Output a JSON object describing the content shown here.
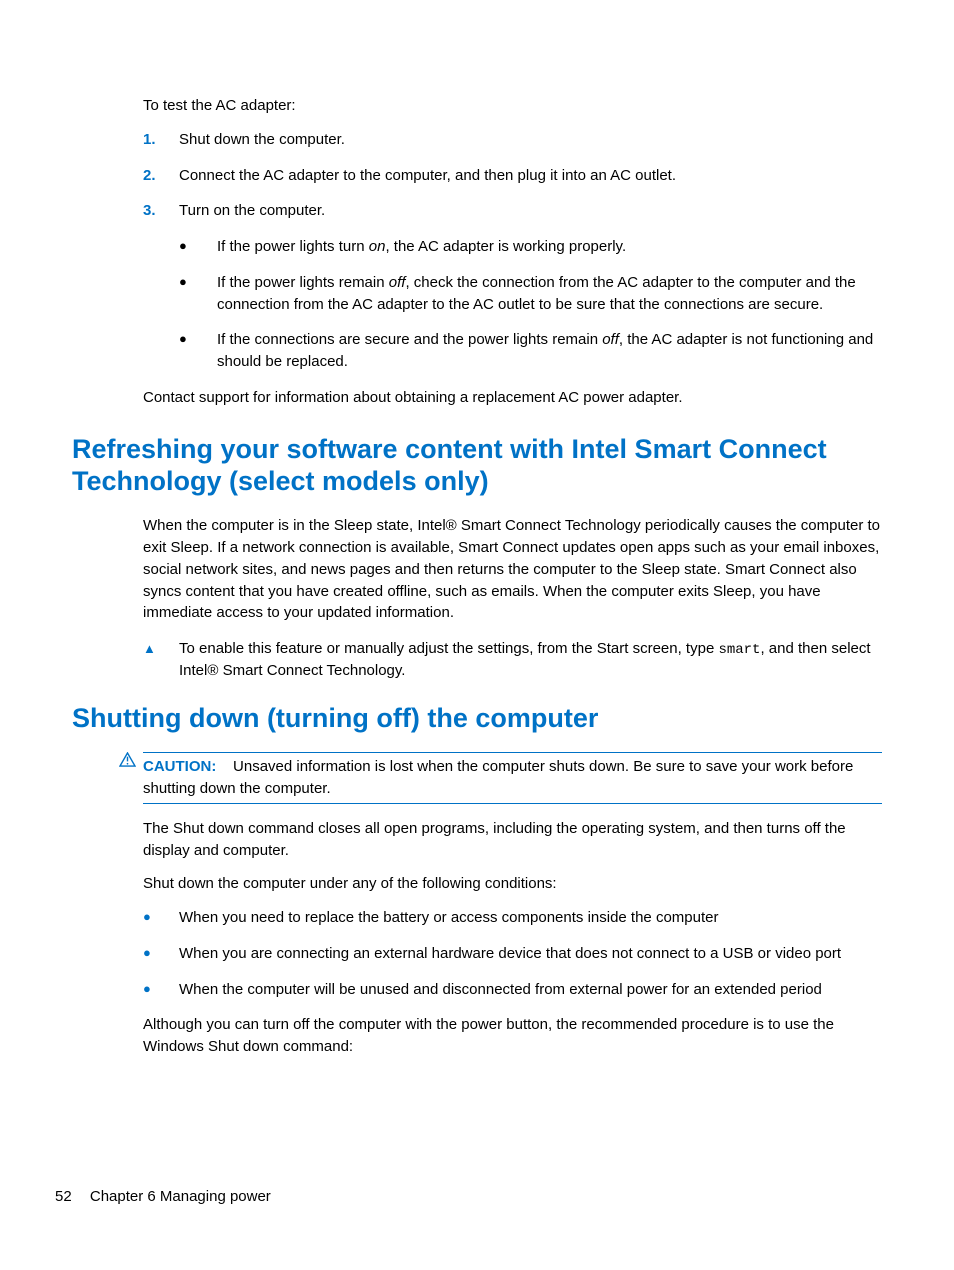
{
  "intro": "To test the AC adapter:",
  "steps": [
    {
      "n": "1.",
      "t": "Shut down the computer."
    },
    {
      "n": "2.",
      "t": "Connect the AC adapter to the computer, and then plug it into an AC outlet."
    },
    {
      "n": "3.",
      "t": "Turn on the computer."
    }
  ],
  "substeps": {
    "s1a": "If the power lights turn ",
    "s1b": "on",
    "s1c": ", the AC adapter is working properly.",
    "s2a": "If the power lights remain ",
    "s2b": "off",
    "s2c": ", check the connection from the AC adapter to the computer and the connection from the AC adapter to the AC outlet to be sure that the connections are secure.",
    "s3a": "If the connections are secure and the power lights remain ",
    "s3b": "off",
    "s3c": ", the AC adapter is not functioning and should be replaced."
  },
  "contact": "Contact support for information about obtaining a replacement AC power adapter.",
  "heading1": "Refreshing your software content with Intel Smart Connect Technology (select models only)",
  "refresh_para": "When the computer is in the Sleep state, Intel® Smart Connect Technology periodically causes the computer to exit Sleep. If a network connection is available, Smart Connect updates open apps such as your email inboxes, social network sites, and news pages and then returns the computer to the Sleep state. Smart Connect also syncs content that you have created offline, such as emails. When the computer exits Sleep, you have immediate access to your updated information.",
  "tip_a": "To enable this feature or manually adjust the settings, from the Start screen, type ",
  "tip_code": "smart",
  "tip_b": ", and then select Intel® Smart Connect Technology.",
  "heading2": "Shutting down (turning off) the computer",
  "caution_label": "CAUTION:",
  "caution_text": "Unsaved information is lost when the computer shuts down. Be sure to save your work before shutting down the computer.",
  "shut_p1": "The Shut down command closes all open programs, including the operating system, and then turns off the display and computer.",
  "shut_p2": "Shut down the computer under any of the following conditions:",
  "shut_list": [
    "When you need to replace the battery or access components inside the computer",
    "When you are connecting an external hardware device that does not connect to a USB or video port",
    "When the computer will be unused and disconnected from external power for an extended period"
  ],
  "shut_p3": "Although you can turn off the computer with the power button, the recommended procedure is to use the Windows Shut down command:",
  "footer": {
    "page": "52",
    "chapter": "Chapter 6   Managing power"
  }
}
